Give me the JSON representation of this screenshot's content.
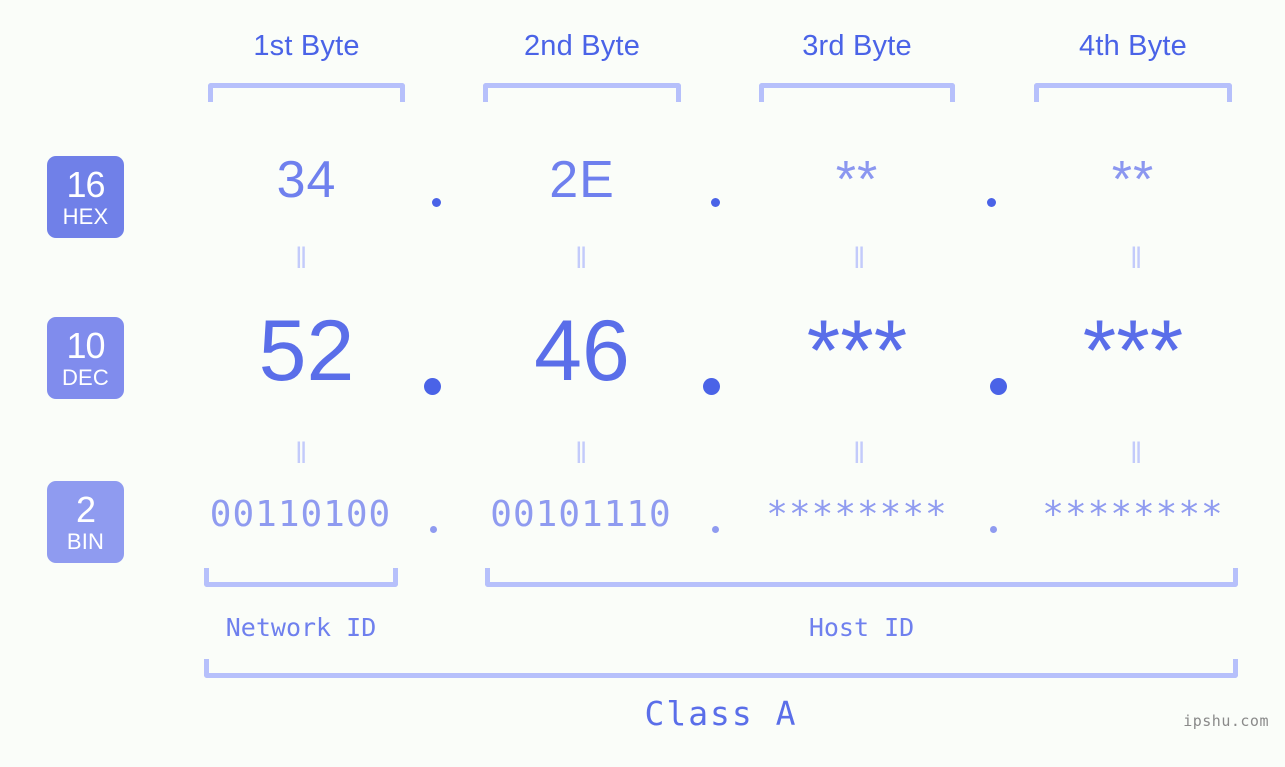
{
  "meta": {
    "background_color": "#fafdf9",
    "accent_color": "#4a63e7",
    "light_accent_color": "#b6c0fb",
    "value_color": "#6f80ee"
  },
  "byte_headers": [
    {
      "label": "1st Byte"
    },
    {
      "label": "2nd Byte"
    },
    {
      "label": "3rd Byte"
    },
    {
      "label": "4th Byte"
    }
  ],
  "bases": [
    {
      "num": "16",
      "name": "HEX",
      "color": "#7080e8"
    },
    {
      "num": "10",
      "name": "DEC",
      "color": "#808ced"
    },
    {
      "num": "2",
      "name": "BIN",
      "color": "#8f9bf0"
    }
  ],
  "rows": {
    "hex": {
      "values": [
        "34",
        "2E",
        "**",
        "**"
      ],
      "separator": "."
    },
    "dec": {
      "values": [
        "52",
        "46",
        "***",
        "***"
      ],
      "separator": "."
    },
    "bin": {
      "values": [
        "00110100",
        "00101110",
        "********",
        "********"
      ],
      "separator": "."
    }
  },
  "equality_symbol": "‖",
  "sections": {
    "network_id": "Network ID",
    "host_id": "Host ID",
    "class": "Class A"
  },
  "watermark": "ipshu.com"
}
